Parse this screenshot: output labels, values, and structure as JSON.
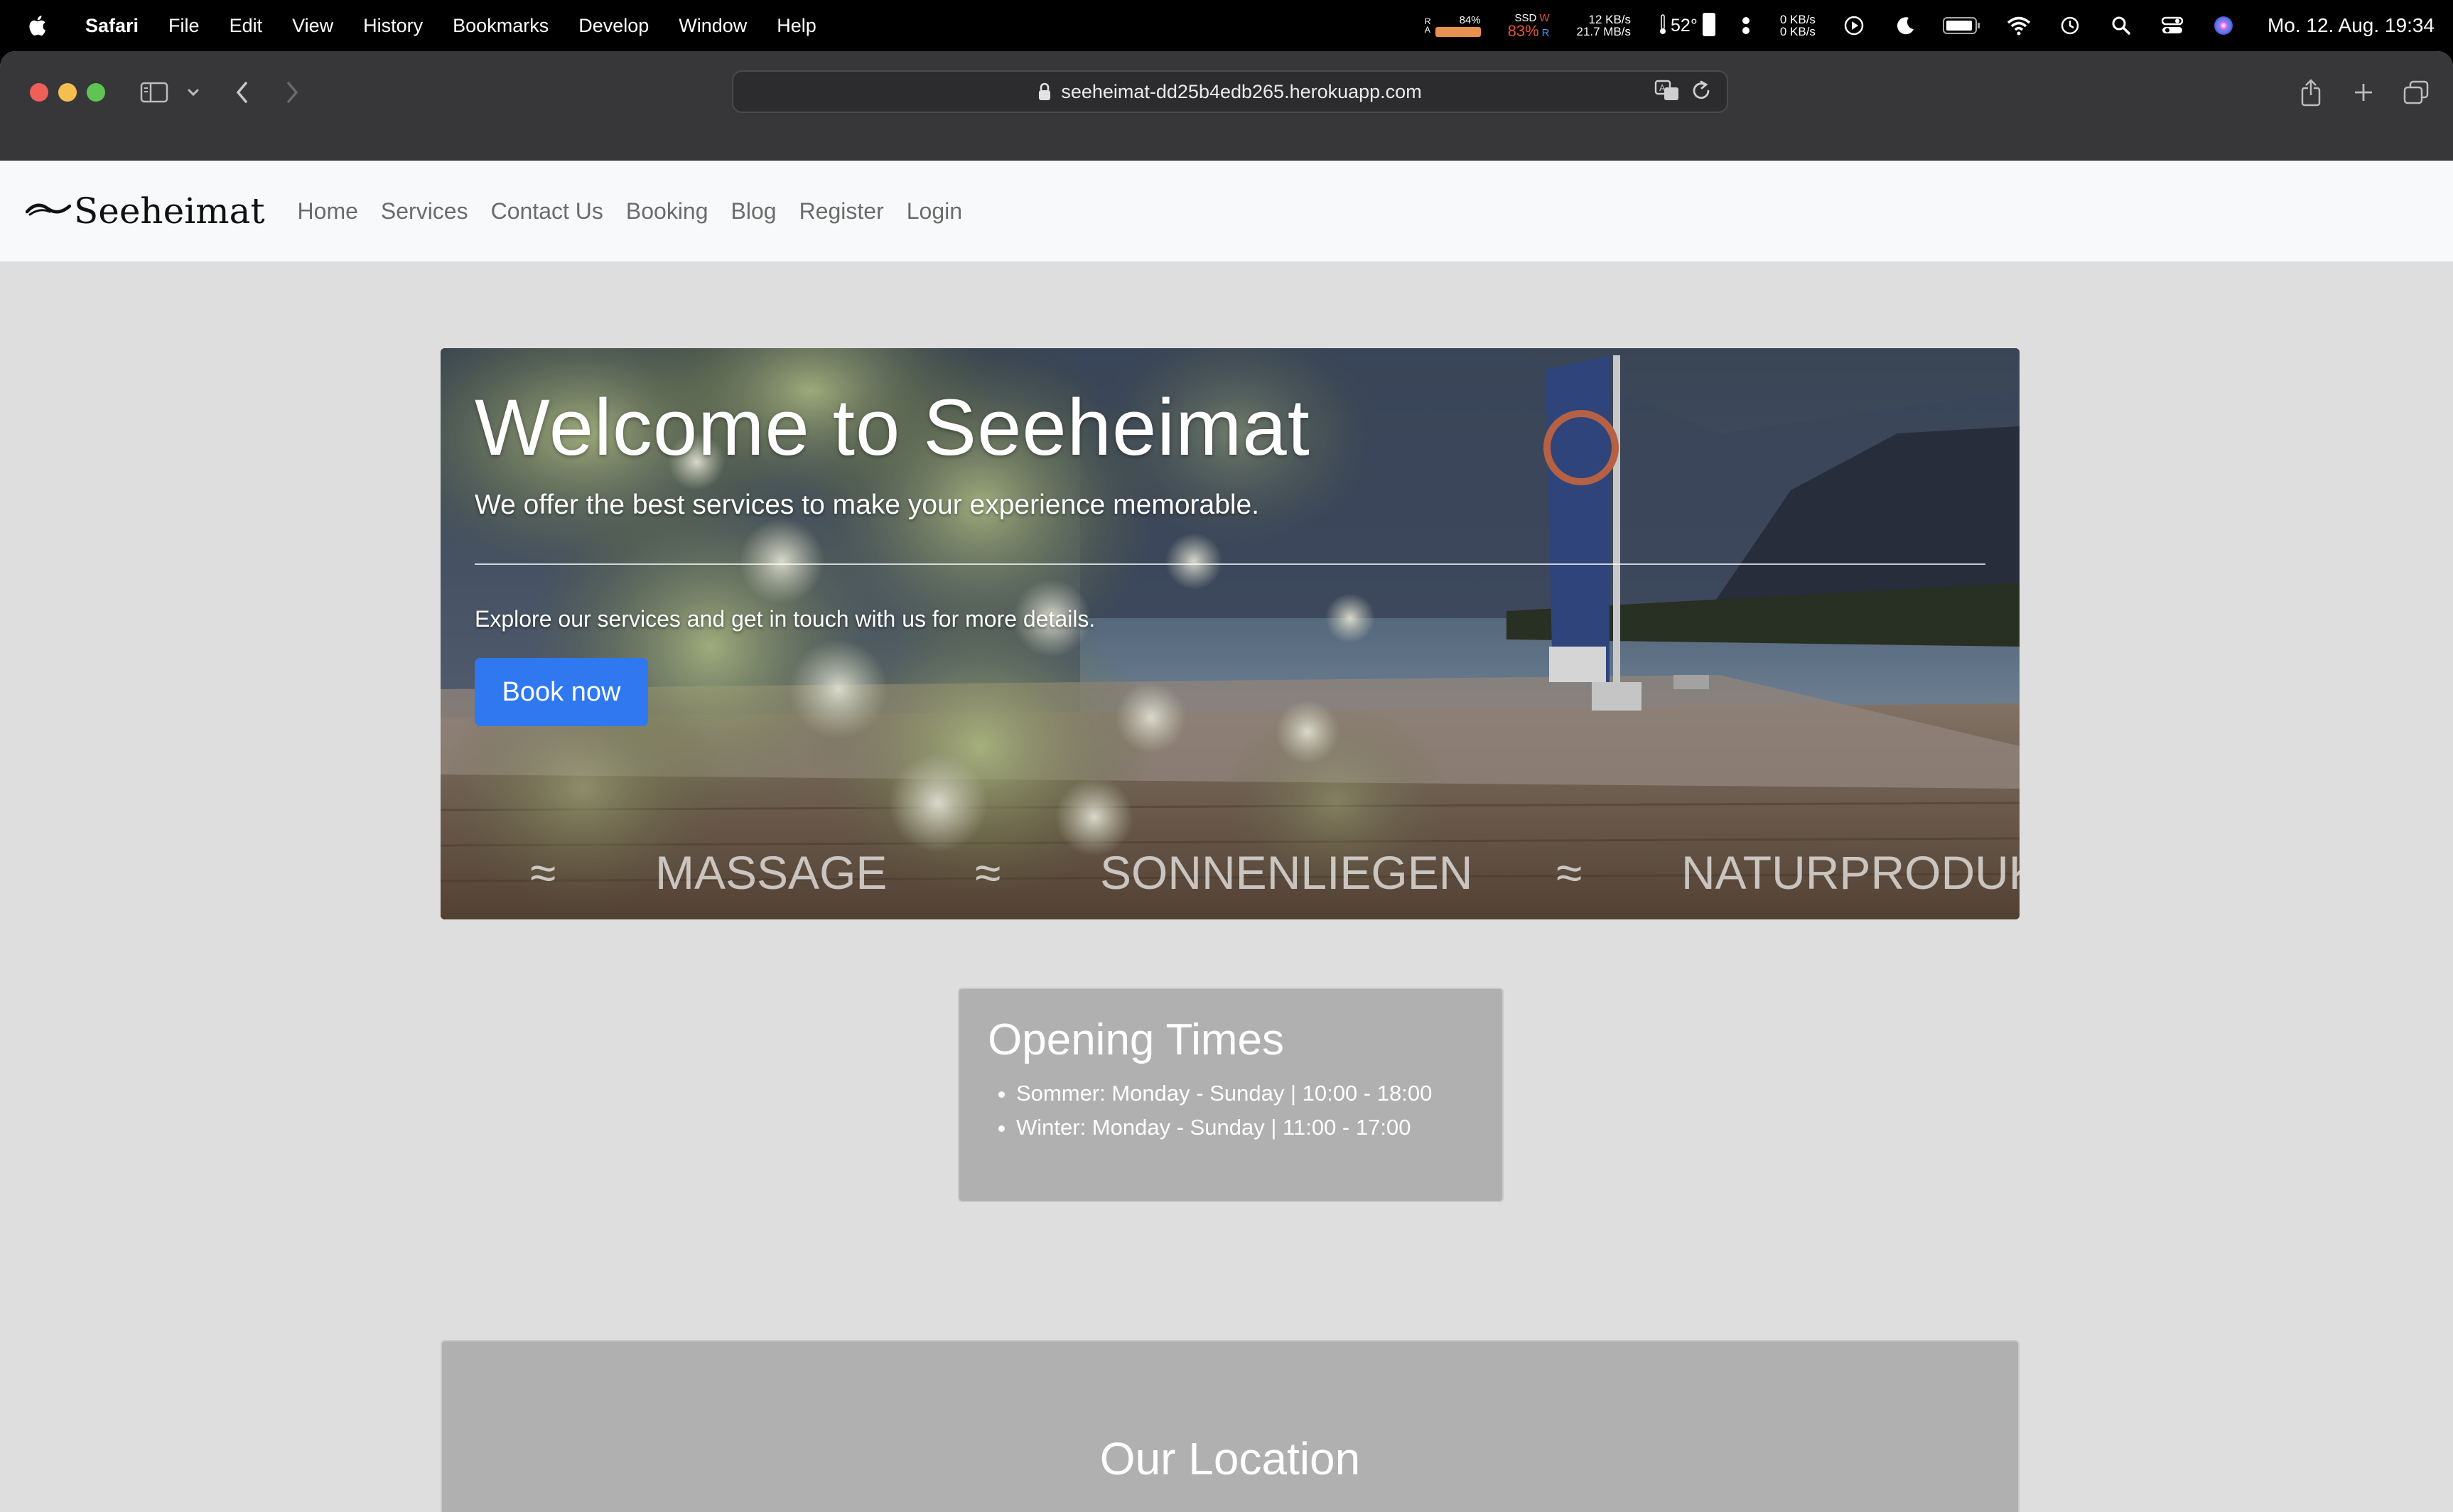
{
  "menubar": {
    "app_name": "Safari",
    "items": [
      "File",
      "Edit",
      "View",
      "History",
      "Bookmarks",
      "Develop",
      "Window",
      "Help"
    ],
    "status": {
      "ram_label": "R\nA",
      "ram_percent": "84%",
      "ssd_label": "SSD",
      "ssd_percent": "83%",
      "ssd_w": "W",
      "ssd_r": "R",
      "disk_write": "12 KB/s",
      "disk_read": "21.7 MB/s",
      "temp": "52°",
      "net_up": "0 KB/s",
      "net_down": "0 KB/s",
      "datetime": "Mo. 12. Aug.  19:34"
    }
  },
  "browser": {
    "url": "seeheimat-dd25b4edb265.herokuapp.com"
  },
  "site": {
    "brand": "Seeheimat",
    "nav": [
      "Home",
      "Services",
      "Contact Us",
      "Booking",
      "Blog",
      "Register",
      "Login"
    ],
    "hero": {
      "title": "Welcome to Seeheimat",
      "subtitle": "We offer the best services to make your experience memorable.",
      "text": "Explore our services and get in touch with us for more details.",
      "button": "Book now",
      "marquee": [
        "≈",
        "MASSAGE",
        "≈",
        "SONNENLIEGEN",
        "≈",
        "NATURPRODUK"
      ]
    },
    "opening_times": {
      "title": "Opening Times",
      "items": [
        "Sommer: Monday - Sunday | 10:00 - 18:00",
        "Winter: Monday - Sunday | 11:00 - 17:00"
      ]
    },
    "location": {
      "title": "Our Location"
    }
  }
}
